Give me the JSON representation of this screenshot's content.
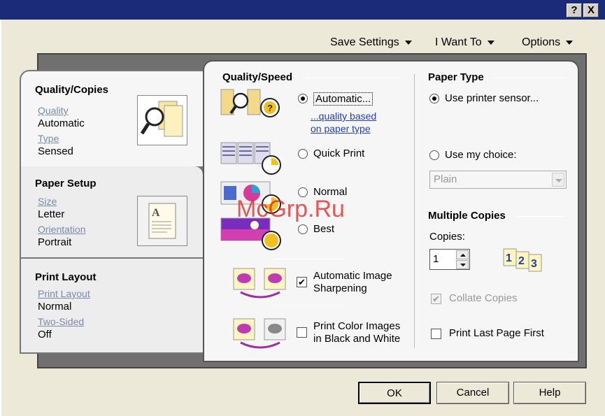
{
  "titlebar": {
    "help_label": "?",
    "close_label": "X"
  },
  "menu": {
    "save_settings": "Save Settings",
    "i_want_to": "I Want To",
    "options": "Options"
  },
  "tabs": {
    "quality_copies": {
      "title": "Quality/Copies",
      "quality_label": "Quality",
      "quality_value": "Automatic",
      "type_label": "Type",
      "type_value": "Sensed"
    },
    "paper_setup": {
      "title": "Paper Setup",
      "size_label": "Size",
      "size_value": "Letter",
      "orientation_label": "Orientation",
      "orientation_value": "Portrait"
    },
    "print_layout": {
      "title": "Print Layout",
      "layout_label": "Print Layout",
      "layout_value": "Normal",
      "two_sided_label": "Two-Sided",
      "two_sided_value": "Off"
    }
  },
  "quality_speed": {
    "title": "Quality/Speed",
    "automatic": "Automatic...",
    "link_line1": "...quality based",
    "link_line2": "on paper type",
    "quick_print": "Quick Print",
    "normal": "Normal",
    "best": "Best",
    "selected": "automatic",
    "sharpening_line1": "Automatic Image",
    "sharpening_line2": "Sharpening",
    "sharpening_checked": true,
    "bw_line1": "Print Color Images",
    "bw_line2": "in Black and White",
    "bw_checked": false
  },
  "paper_type": {
    "title": "Paper Type",
    "use_sensor": "Use printer sensor...",
    "use_choice": "Use my choice:",
    "dropdown_value": "Plain"
  },
  "multiple_copies": {
    "title": "Multiple Copies",
    "copies_label": "Copies:",
    "copies_value": "1",
    "collate": "Collate Copies",
    "last_page_first": "Print Last Page First"
  },
  "buttons": {
    "ok": "OK",
    "cancel": "Cancel",
    "help": "Help"
  },
  "watermark": "McGrp.Ru"
}
